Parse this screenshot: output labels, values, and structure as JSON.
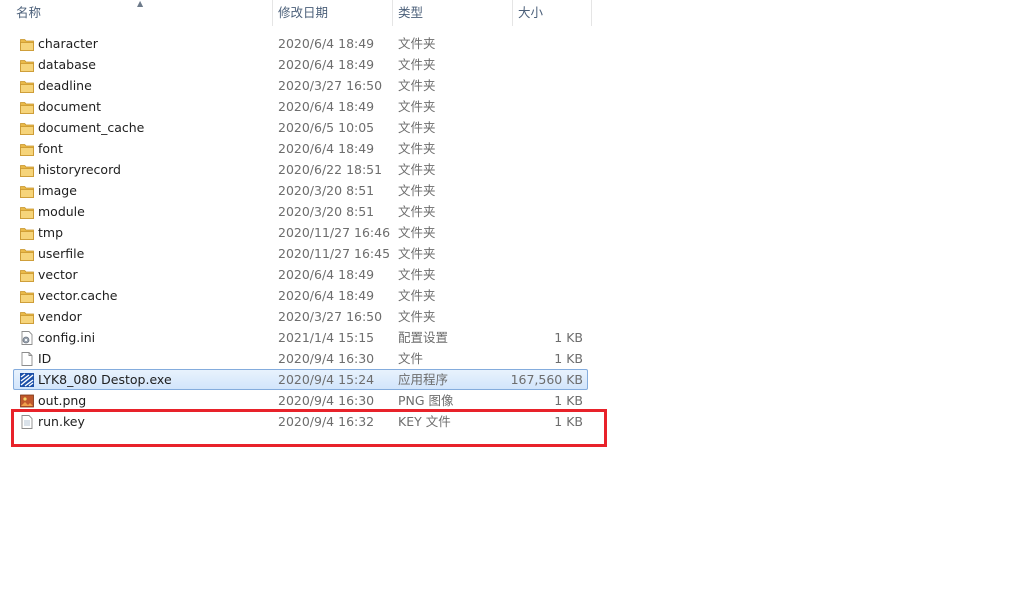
{
  "columns": {
    "name": "名称",
    "date_modified": "修改日期",
    "type": "类型",
    "size": "大小"
  },
  "sort_indicator": "▲",
  "colors": {
    "header_text": "#4c607a",
    "folder": "#e8b84a",
    "selection": "#d2e5fb",
    "highlight_box": "#e8222a"
  },
  "files": [
    {
      "name": "character",
      "date": "2020/6/4 18:49",
      "type": "文件夹",
      "size": "",
      "icon": "folder-icon"
    },
    {
      "name": "database",
      "date": "2020/6/4 18:49",
      "type": "文件夹",
      "size": "",
      "icon": "folder-icon"
    },
    {
      "name": "deadline",
      "date": "2020/3/27 16:50",
      "type": "文件夹",
      "size": "",
      "icon": "folder-icon"
    },
    {
      "name": "document",
      "date": "2020/6/4 18:49",
      "type": "文件夹",
      "size": "",
      "icon": "folder-icon"
    },
    {
      "name": "document_cache",
      "date": "2020/6/5 10:05",
      "type": "文件夹",
      "size": "",
      "icon": "folder-icon"
    },
    {
      "name": "font",
      "date": "2020/6/4 18:49",
      "type": "文件夹",
      "size": "",
      "icon": "folder-icon"
    },
    {
      "name": "historyrecord",
      "date": "2020/6/22 18:51",
      "type": "文件夹",
      "size": "",
      "icon": "folder-icon"
    },
    {
      "name": "image",
      "date": "2020/3/20 8:51",
      "type": "文件夹",
      "size": "",
      "icon": "folder-icon"
    },
    {
      "name": "module",
      "date": "2020/3/20 8:51",
      "type": "文件夹",
      "size": "",
      "icon": "folder-icon"
    },
    {
      "name": "tmp",
      "date": "2020/11/27 16:46",
      "type": "文件夹",
      "size": "",
      "icon": "folder-icon"
    },
    {
      "name": "userfile",
      "date": "2020/11/27 16:45",
      "type": "文件夹",
      "size": "",
      "icon": "folder-icon"
    },
    {
      "name": "vector",
      "date": "2020/6/4 18:49",
      "type": "文件夹",
      "size": "",
      "icon": "folder-icon"
    },
    {
      "name": "vector.cache",
      "date": "2020/6/4 18:49",
      "type": "文件夹",
      "size": "",
      "icon": "folder-icon"
    },
    {
      "name": "vendor",
      "date": "2020/3/27 16:50",
      "type": "文件夹",
      "size": "",
      "icon": "folder-icon"
    },
    {
      "name": "config.ini",
      "date": "2021/1/4 15:15",
      "type": "配置设置",
      "size": "1 KB",
      "icon": "config-file-icon"
    },
    {
      "name": "ID",
      "date": "2020/9/4 16:30",
      "type": "文件",
      "size": "1 KB",
      "icon": "blank-file-icon"
    },
    {
      "name": "LYK8_080 Destop.exe",
      "date": "2020/9/4 15:24",
      "type": "应用程序",
      "size": "167,560 KB",
      "icon": "application-icon",
      "selected": true
    },
    {
      "name": "out.png",
      "date": "2020/9/4 16:30",
      "type": "PNG 图像",
      "size": "1 KB",
      "icon": "image-file-icon"
    },
    {
      "name": "run.key",
      "date": "2020/9/4 16:32",
      "type": "KEY 文件",
      "size": "1 KB",
      "icon": "text-file-icon"
    }
  ]
}
